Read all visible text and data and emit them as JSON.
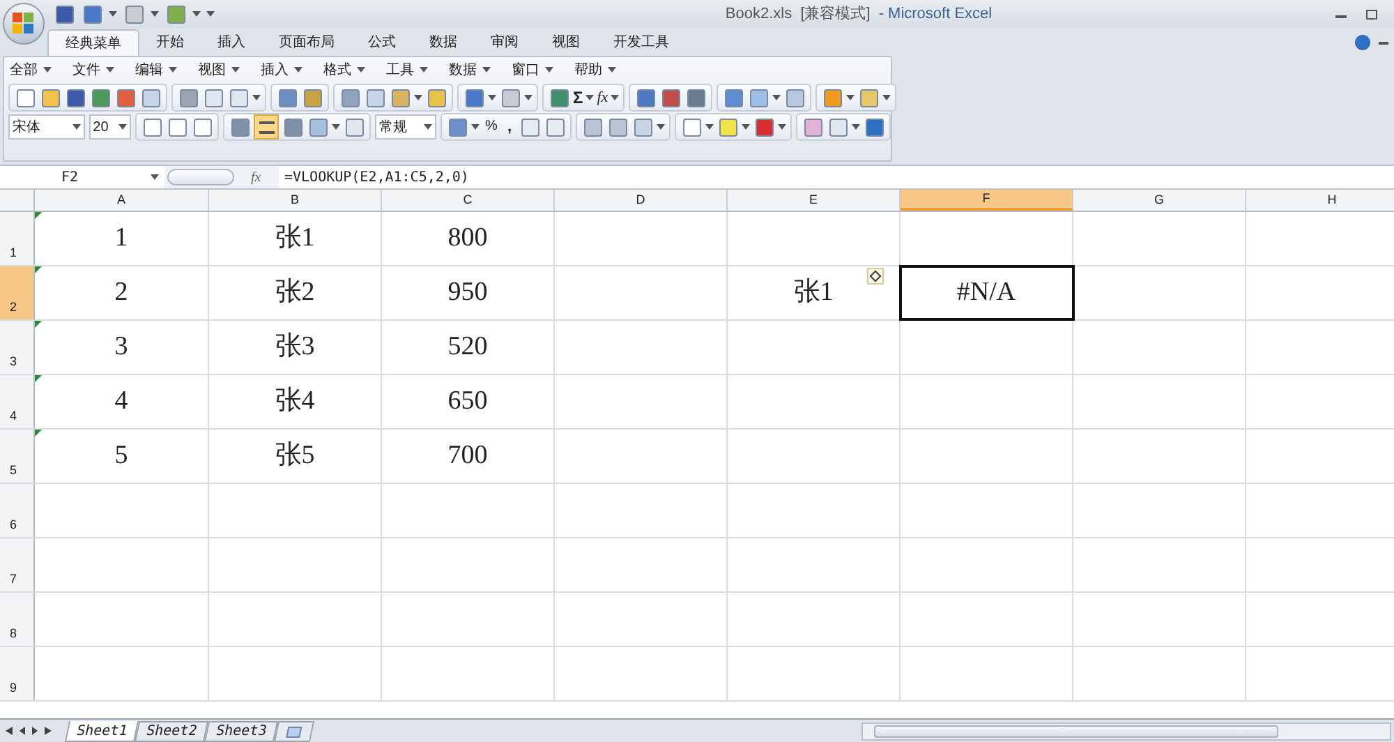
{
  "window": {
    "title": "Book2.xls  [兼容模式]",
    "app": "- Microsoft Excel"
  },
  "ribbon_tabs": [
    {
      "label": "经典菜单",
      "selected": true
    },
    {
      "label": "开始",
      "selected": false
    },
    {
      "label": "插入",
      "selected": false
    },
    {
      "label": "页面布局",
      "selected": false
    },
    {
      "label": "公式",
      "selected": false
    },
    {
      "label": "数据",
      "selected": false
    },
    {
      "label": "审阅",
      "selected": false
    },
    {
      "label": "视图",
      "selected": false
    },
    {
      "label": "开发工具",
      "selected": false
    }
  ],
  "menus": [
    "全部",
    "文件",
    "编辑",
    "视图",
    "插入",
    "格式",
    "工具",
    "数据",
    "窗口",
    "帮助"
  ],
  "toolbar_glyphs": {
    "sum": "Σ",
    "function": "fx",
    "percent": "%",
    "comma": ","
  },
  "font_name": "宋体",
  "font_size": "20",
  "number_format": "常规",
  "center_align_on": true,
  "name_box": "F2",
  "fx": "fx",
  "formula": "=VLOOKUP(E2,A1:C5,2,0)",
  "columns": [
    {
      "label": "A",
      "selected": false
    },
    {
      "label": "B",
      "selected": false
    },
    {
      "label": "C",
      "selected": false
    },
    {
      "label": "D",
      "selected": false
    },
    {
      "label": "E",
      "selected": false
    },
    {
      "label": "F",
      "selected": true
    },
    {
      "label": "G",
      "selected": false
    },
    {
      "label": "H",
      "selected": false
    }
  ],
  "rows": [
    {
      "header": "1",
      "selected": false,
      "cells": [
        {
          "text": "1",
          "warning": true,
          "active": false
        },
        {
          "text": "张1",
          "warning": false,
          "active": false
        },
        {
          "text": "800",
          "warning": false,
          "active": false
        },
        null,
        null,
        null,
        null,
        null
      ]
    },
    {
      "header": "2",
      "selected": true,
      "cells": [
        {
          "text": "2",
          "warning": true,
          "active": false
        },
        {
          "text": "张2",
          "warning": false,
          "active": false
        },
        {
          "text": "950",
          "warning": false,
          "active": false
        },
        null,
        {
          "text": "张1",
          "warning": false,
          "active": false
        },
        {
          "text": "#N/A",
          "warning": false,
          "active": true
        },
        null,
        null
      ]
    },
    {
      "header": "3",
      "selected": false,
      "cells": [
        {
          "text": "3",
          "warning": true,
          "active": false
        },
        {
          "text": "张3",
          "warning": false,
          "active": false
        },
        {
          "text": "520",
          "warning": false,
          "active": false
        },
        null,
        null,
        null,
        null,
        null
      ]
    },
    {
      "header": "4",
      "selected": false,
      "cells": [
        {
          "text": "4",
          "warning": true,
          "active": false
        },
        {
          "text": "张4",
          "warning": false,
          "active": false
        },
        {
          "text": "650",
          "warning": false,
          "active": false
        },
        null,
        null,
        null,
        null,
        null
      ]
    },
    {
      "header": "5",
      "selected": false,
      "cells": [
        {
          "text": "5",
          "warning": true,
          "active": false
        },
        {
          "text": "张5",
          "warning": false,
          "active": false
        },
        {
          "text": "700",
          "warning": false,
          "active": false
        },
        null,
        null,
        null,
        null,
        null
      ]
    },
    {
      "header": "6",
      "selected": false,
      "cells": [
        null,
        null,
        null,
        null,
        null,
        null,
        null,
        null
      ]
    },
    {
      "header": "7",
      "selected": false,
      "cells": [
        null,
        null,
        null,
        null,
        null,
        null,
        null,
        null
      ]
    },
    {
      "header": "8",
      "selected": false,
      "cells": [
        null,
        null,
        null,
        null,
        null,
        null,
        null,
        null
      ]
    },
    {
      "header": "9",
      "selected": false,
      "cells": [
        null,
        null,
        null,
        null,
        null,
        null,
        null,
        null
      ]
    }
  ],
  "error_indicator": true,
  "sheet_tabs": [
    {
      "label": "Sheet1",
      "selected": true
    },
    {
      "label": "Sheet2",
      "selected": false
    },
    {
      "label": "Sheet3",
      "selected": false
    }
  ]
}
